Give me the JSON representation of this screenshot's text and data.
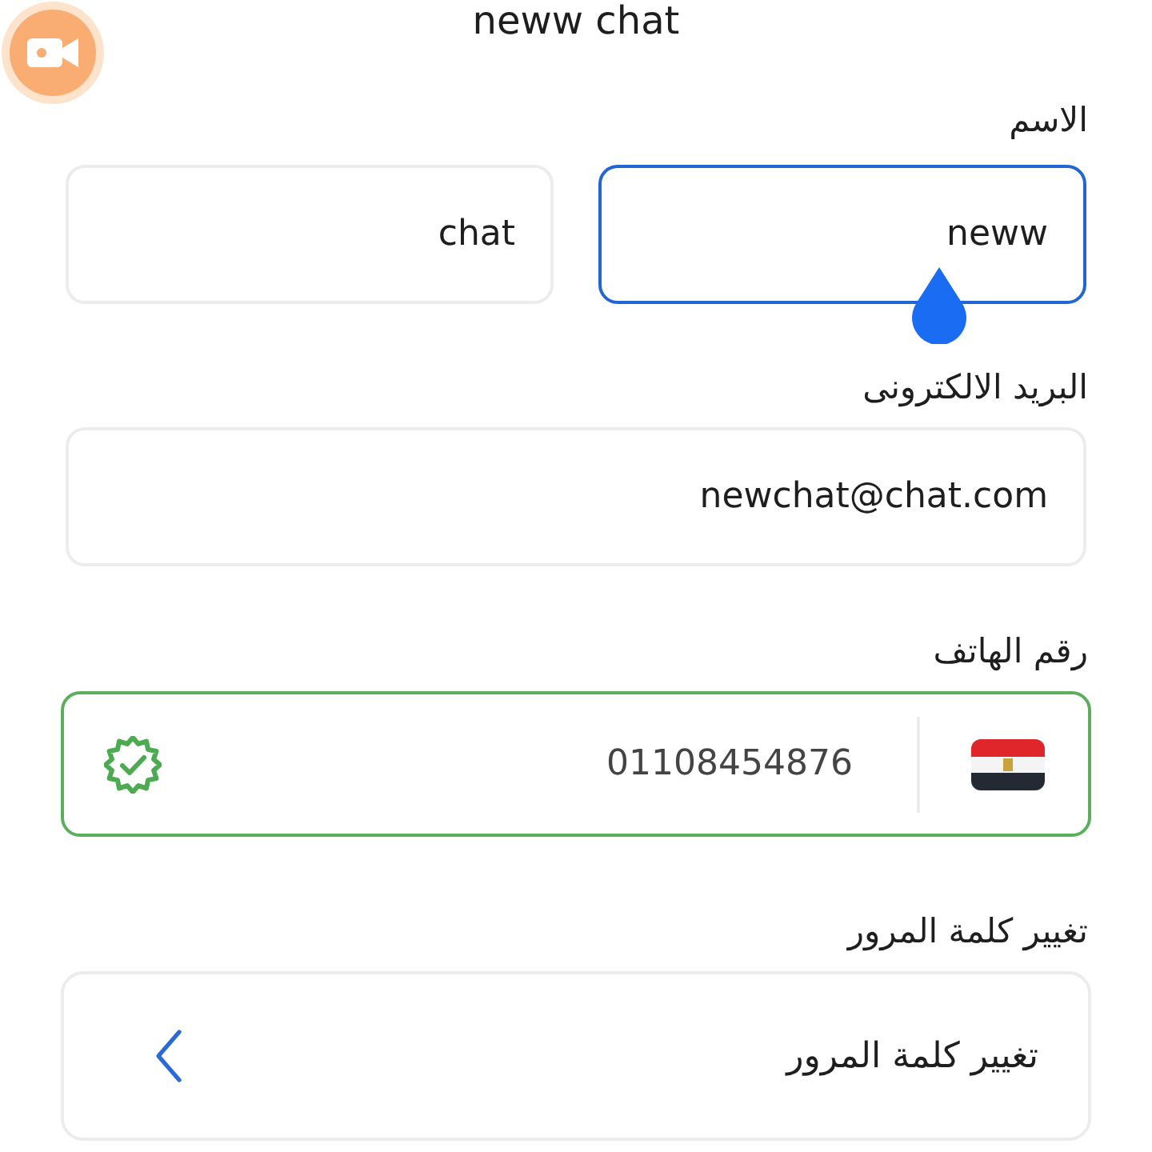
{
  "header": {
    "title": "neww chat"
  },
  "name": {
    "label": "الاسم",
    "fields": [
      {
        "value": "neww",
        "focused": true
      },
      {
        "value": "chat",
        "focused": false
      }
    ]
  },
  "email": {
    "label": "البريد الالكترونى",
    "value": "newchat@chat.com"
  },
  "phone": {
    "label": "رقم الهاتف",
    "value": "01108454876",
    "verified": true
  },
  "password": {
    "label": "تغيير كلمة المرور",
    "button": "تغيير كلمة المرور"
  }
}
